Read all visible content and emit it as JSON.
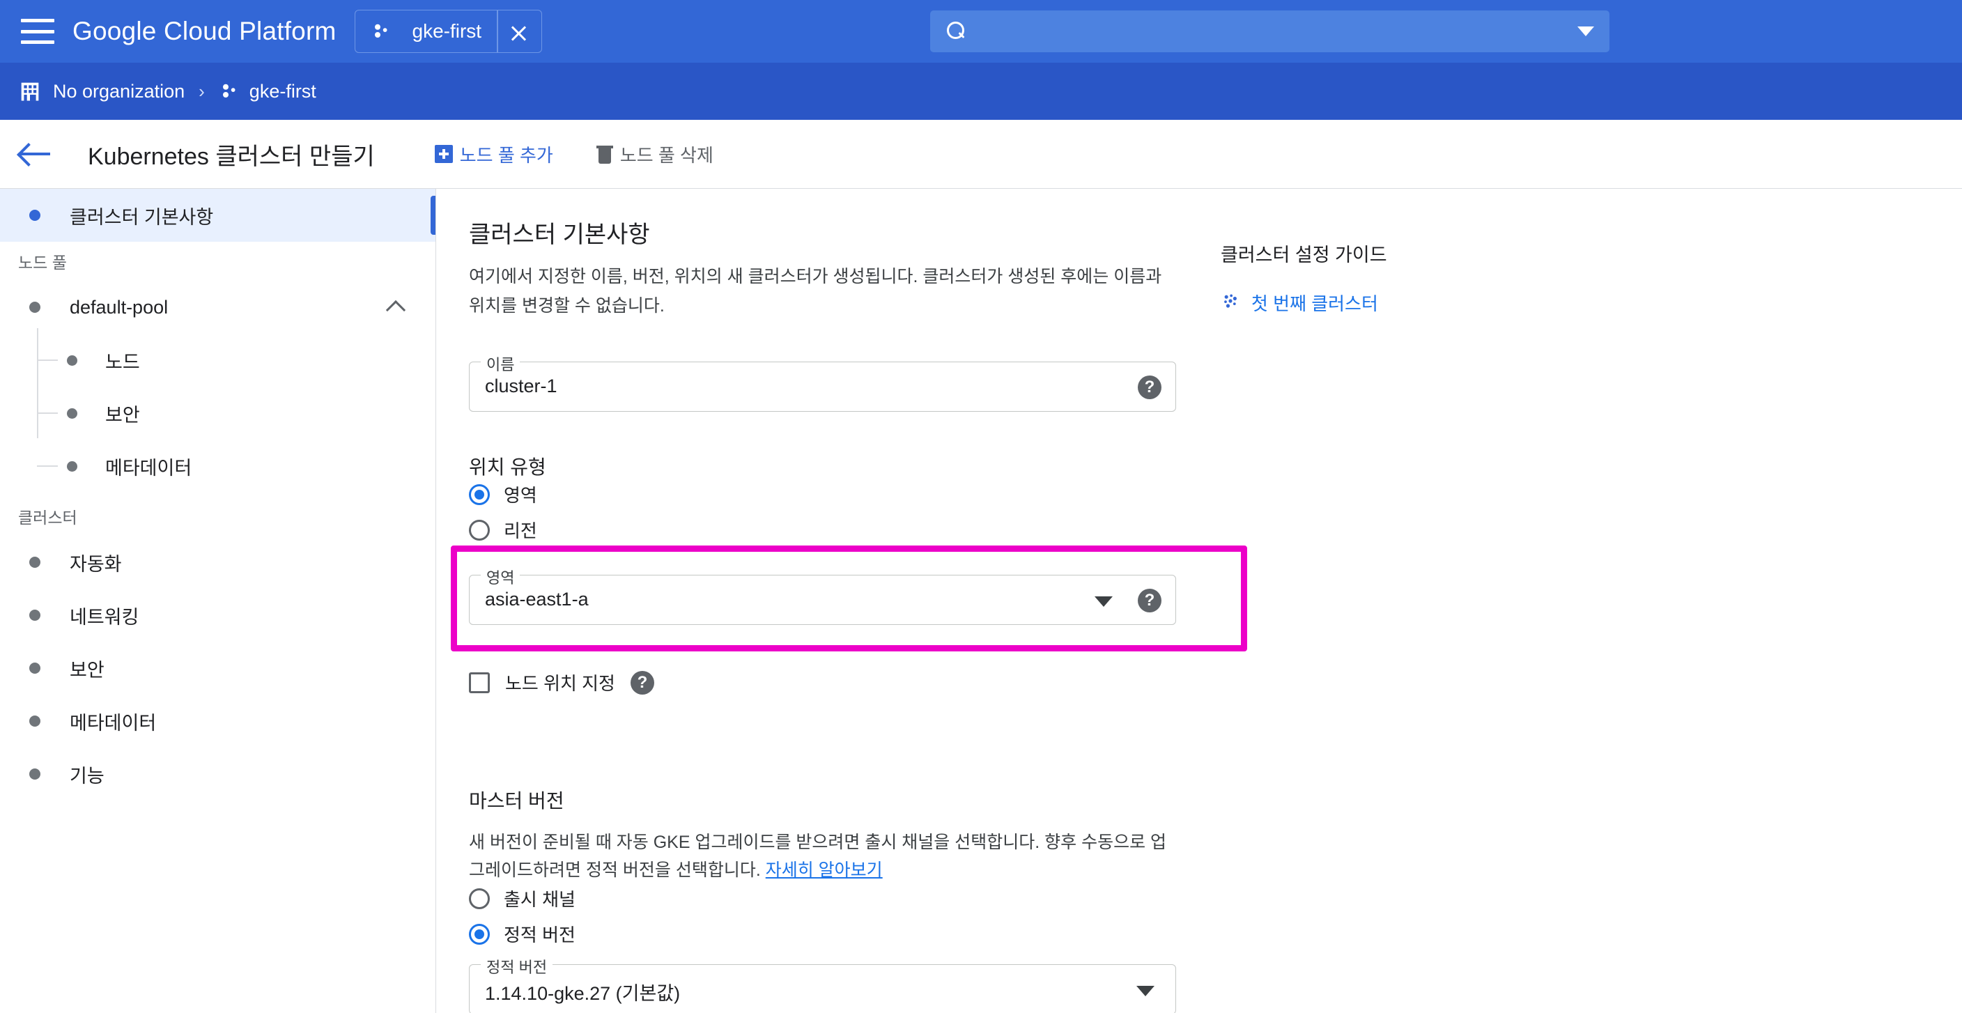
{
  "topbar": {
    "menu_icon": "hamburger-menu-icon",
    "brand": "Google Cloud Platform",
    "project_chip": {
      "icon": "project-dots-icon",
      "label": "gke-first",
      "expand_icon": "expand-collapse-chevrons-icon"
    },
    "search": {
      "icon": "search-icon",
      "value": "",
      "placeholder": "",
      "dropdown_icon": "caret-down-icon"
    }
  },
  "breadcrumb": {
    "org_icon": "organization-building-icon",
    "org": "No organization",
    "separator": "›",
    "project_icon": "project-dots-icon",
    "project": "gke-first"
  },
  "page_header": {
    "back_icon": "back-arrow-icon",
    "title": "Kubernetes 클러스터 만들기",
    "add_node_pool": {
      "icon": "plus-square-icon",
      "label": "노드 풀 추가"
    },
    "delete_node_pool": {
      "icon": "trash-icon",
      "label": "노드 풀 삭제"
    }
  },
  "sidebar": {
    "active_item": "클러스터 기본사항",
    "node_pool_section": "노드 풀",
    "pool": {
      "name": "default-pool",
      "collapse_icon": "chevron-up-icon"
    },
    "pool_children": [
      "노드",
      "보안",
      "메타데이터"
    ],
    "cluster_section": "클러스터",
    "cluster_items": [
      "자동화",
      "네트워킹",
      "보안",
      "메타데이터",
      "기능"
    ]
  },
  "main": {
    "title": "클러스터 기본사항",
    "description": "여기에서 지정한 이름, 버전, 위치의 새 클러스터가 생성됩니다. 클러스터가 생성된 후에는 이름과 위치를 변경할 수 없습니다.",
    "name_field": {
      "label": "이름",
      "value": "cluster-1",
      "help_icon": "help-circle-icon"
    },
    "location_type": {
      "heading": "위치 유형",
      "options": [
        {
          "label": "영역",
          "selected": true
        },
        {
          "label": "리전",
          "selected": false
        }
      ]
    },
    "zone_field": {
      "label": "영역",
      "value": "asia-east1-a",
      "dropdown_icon": "caret-down-icon",
      "help_icon": "help-circle-icon",
      "highlight_color": "#ec00c8"
    },
    "node_locations": {
      "label": "노드 위치 지정",
      "checked": false,
      "help_icon": "help-circle-icon"
    },
    "master_version": {
      "heading": "마스터 버전",
      "description_before": "새 버전이 준비될 때 자동 GKE 업그레이드를 받으려면 출시 채널을 선택합니다. 향후 수동으로 업그레이드하려면 정적 버전을 선택합니다. ",
      "learn_more": "자세히 알아보기",
      "options": [
        {
          "label": "출시 채널",
          "selected": false
        },
        {
          "label": "정적 버전",
          "selected": true
        }
      ],
      "static_field": {
        "label": "정적 버전",
        "value": "1.14.10-gke.27 (기본값)",
        "dropdown_icon": "caret-down-icon"
      }
    }
  },
  "guide": {
    "title": "클러스터 설정 가이드",
    "link": {
      "icon": "project-dots-icon",
      "label": "첫 번째 클러스터"
    }
  },
  "colors": {
    "topbar": "#3367d6",
    "breadcrumb_bar": "#2a56c6",
    "accent": "#1a73e8",
    "highlight": "#ec00c8",
    "active_nav_bg": "#e8f0fe"
  }
}
